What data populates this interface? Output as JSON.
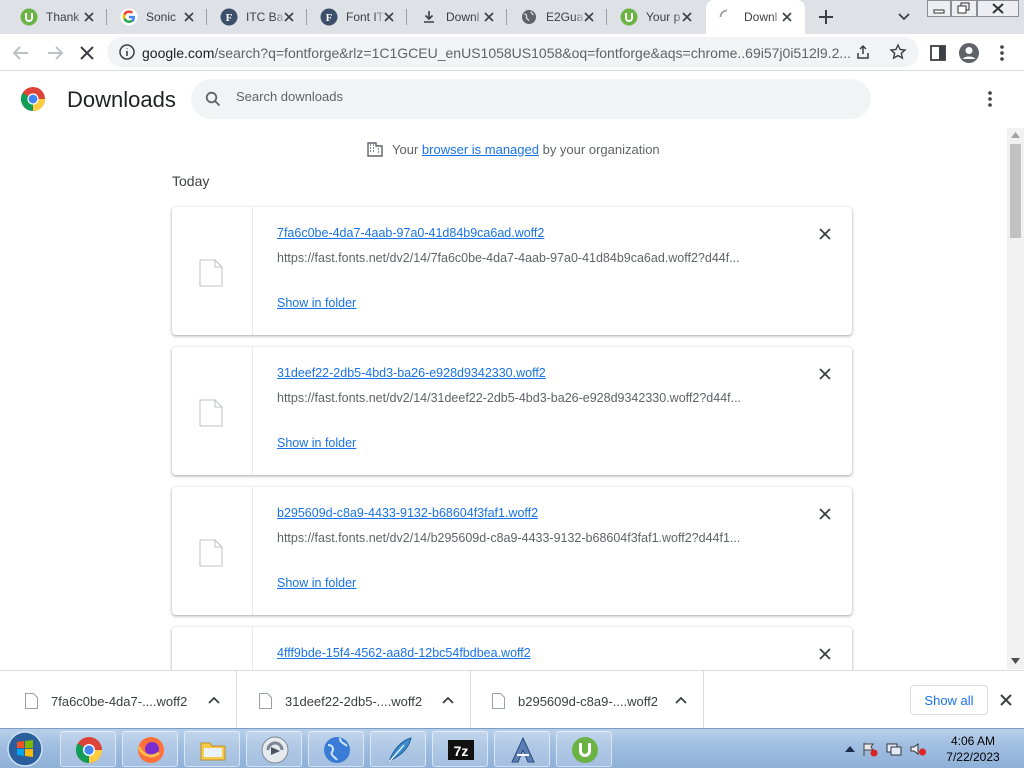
{
  "browser": {
    "tabs": [
      {
        "title": "Thank",
        "icon": "utorrent-icon"
      },
      {
        "title": "Sonic",
        "icon": "google-icon"
      },
      {
        "title": "ITC Ba",
        "icon": "fonts-f-icon"
      },
      {
        "title": "Font IT",
        "icon": "fonts-f-icon"
      },
      {
        "title": "Downl",
        "icon": "download-icon"
      },
      {
        "title": "E2Gua",
        "icon": "globe-icon"
      },
      {
        "title": "Your p",
        "icon": "utorrent-icon"
      },
      {
        "title": "Downl",
        "icon": "loading-spinner-icon",
        "active": true
      }
    ],
    "address": {
      "host": "google.com",
      "path": "/search?q=fontforge&rlz=1C1GCEU_enUS1058US1058&oq=fontforge&aqs=chrome..69i57j0i512l9.2..."
    }
  },
  "page": {
    "title": "Downloads",
    "search_placeholder": "Search downloads",
    "managed": {
      "prefix": "Your",
      "link": "browser is managed",
      "suffix": "by your organization"
    },
    "section_date": "Today",
    "downloads": [
      {
        "name": "7fa6c0be-4da7-4aab-97a0-41d84b9ca6ad.woff2",
        "url": "https://fast.fonts.net/dv2/14/7fa6c0be-4da7-4aab-97a0-41d84b9ca6ad.woff2?d44f...",
        "action": "Show in folder"
      },
      {
        "name": "31deef22-2db5-4bd3-ba26-e928d9342330.woff2",
        "url": "https://fast.fonts.net/dv2/14/31deef22-2db5-4bd3-ba26-e928d9342330.woff2?d44f...",
        "action": "Show in folder"
      },
      {
        "name": "b295609d-c8a9-4433-9132-b68604f3faf1.woff2",
        "url": "https://fast.fonts.net/dv2/14/b295609d-c8a9-4433-9132-b68604f3faf1.woff2?d44f1...",
        "action": "Show in folder"
      },
      {
        "name": "4fff9bde-15f4-4562-aa8d-12bc54fbdbea.woff2",
        "url": "",
        "action": ""
      }
    ]
  },
  "shelf": {
    "items": [
      {
        "name": "7fa6c0be-4da7-....woff2"
      },
      {
        "name": "31deef22-2db5-....woff2"
      },
      {
        "name": "b295609d-c8a9-....woff2"
      }
    ],
    "show_all": "Show all"
  },
  "taskbar": {
    "apps": [
      "chrome-icon",
      "firefox-icon",
      "explorer-folder-icon",
      "media-player-icon",
      "internet-globe-icon",
      "quill-feather-icon",
      "7zip-icon",
      "fontforge-icon",
      "utorrent-icon"
    ],
    "time": "4:06 AM",
    "date": "7/22/2023"
  },
  "colors": {
    "accent": "#1a73e8",
    "tab_strip": "#dee1e6",
    "utorrent": "#6ab344"
  }
}
